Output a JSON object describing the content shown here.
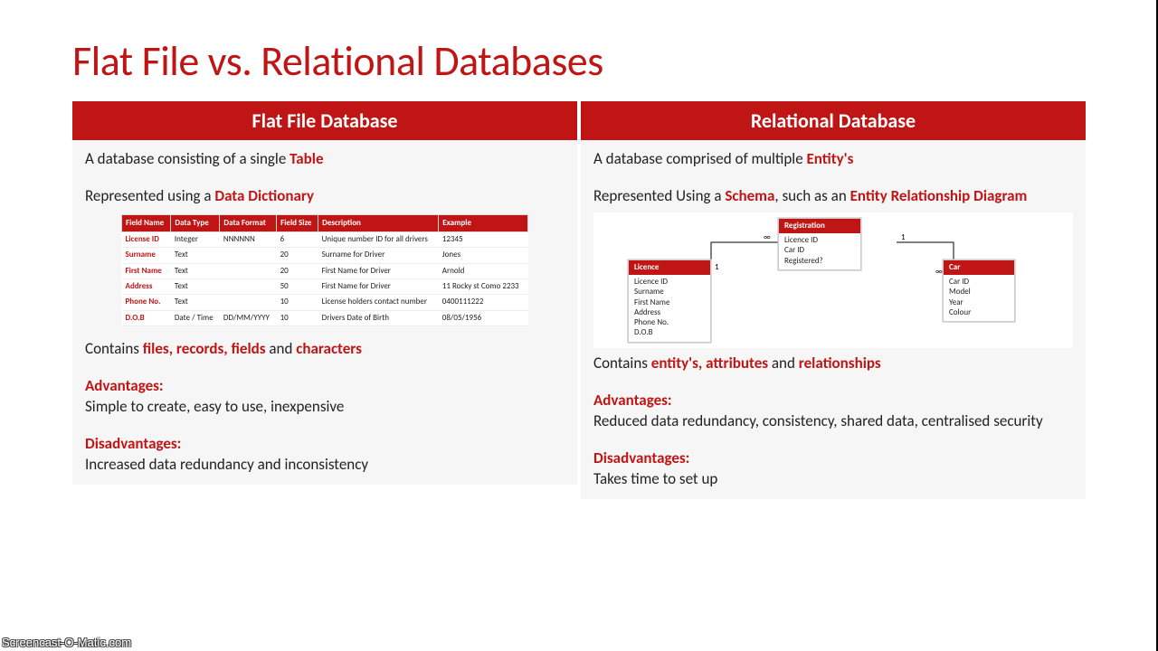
{
  "title": "Flat File vs. Relational Databases",
  "left": {
    "header": "Flat File Database",
    "def_pre": "A database consisting of a single ",
    "def_kw": "Table",
    "rep_pre": "Represented using a ",
    "rep_kw": "Data Dictionary",
    "dd_headers": [
      "Field Name",
      "Data Type",
      "Data Format",
      "Field Size",
      "Description",
      "Example"
    ],
    "dd_rows": [
      [
        "License ID",
        "Integer",
        "NNNNNN",
        "6",
        "Unique number ID for all drivers",
        "12345"
      ],
      [
        "Surname",
        "Text",
        "",
        "20",
        "Surname for Driver",
        "Jones"
      ],
      [
        "First Name",
        "Text",
        "",
        "20",
        "First Name for Driver",
        "Arnold"
      ],
      [
        "Address",
        "Text",
        "",
        "50",
        "First Name for Driver",
        "11 Rocky st Como 2233"
      ],
      [
        "Phone No.",
        "Text",
        "",
        "10",
        "License holders contact number",
        "0400111222"
      ],
      [
        "D.O.B",
        "Date / Time",
        "DD/MM/YYYY",
        "10",
        "Drivers Date of Birth",
        "08/05/1956"
      ]
    ],
    "contains_pre": "Contains ",
    "contains_kw1": "files, records, fields",
    "contains_mid": " and ",
    "contains_kw2": "characters",
    "adv_label": "Advantages:",
    "adv_text": "Simple to create, easy to use, inexpensive",
    "dis_label": "Disadvantages:",
    "dis_text": "Increased data redundancy and inconsistency"
  },
  "right": {
    "header": "Relational Database",
    "def_pre": "A database comprised of multiple ",
    "def_kw": "Entity's",
    "rep_pre": "Represented Using a ",
    "rep_kw1": "Schema",
    "rep_mid": ", such as an ",
    "rep_kw2": "Entity Relationship Diagram",
    "entities": {
      "licence": {
        "name": "Licence",
        "fields": [
          "Licence ID",
          "Surname",
          "First Name",
          "Address",
          "Phone No.",
          "D.O.B"
        ]
      },
      "registration": {
        "name": "Registration",
        "fields": [
          "Licence ID",
          "Car ID",
          "Registered?"
        ]
      },
      "car": {
        "name": "Car",
        "fields": [
          "Car ID",
          "Model",
          "Year",
          "Colour"
        ]
      }
    },
    "card_inf": "∞",
    "card_one": "1",
    "contains_pre": "Contains ",
    "contains_kw1": "entity's, attributes",
    "contains_mid": " and ",
    "contains_kw2": "relationships",
    "adv_label": "Advantages:",
    "adv_text": "Reduced data redundancy, consistency, shared data, centralised security",
    "dis_label": "Disadvantages:",
    "dis_text": "Takes time to set up"
  },
  "watermark": "Screencast-O-Matic.com"
}
